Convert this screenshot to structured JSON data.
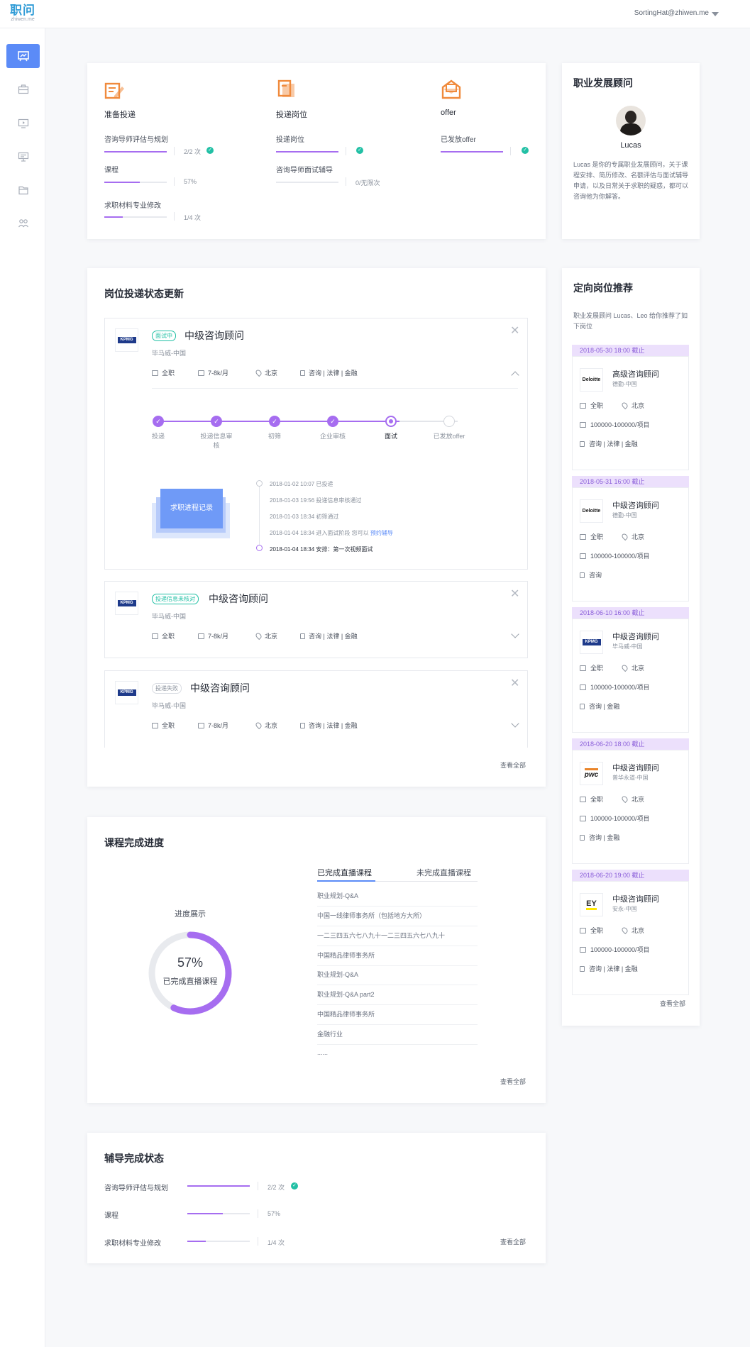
{
  "header": {
    "logo_cn": "职问",
    "logo_en": "zhiwen.me",
    "user_email": "SortingHat@zhiwen.me"
  },
  "sidebar": {
    "items": [
      {
        "icon": "presentation-chart-icon",
        "active": true
      },
      {
        "icon": "briefcase-icon",
        "active": false
      },
      {
        "icon": "monitor-icon",
        "active": false
      },
      {
        "icon": "resume-icon",
        "active": false
      },
      {
        "icon": "folder-icon",
        "active": false
      },
      {
        "icon": "people-icon",
        "active": false
      }
    ]
  },
  "overview": {
    "col1": {
      "title": "准备投递",
      "rows": [
        {
          "label": "咨询导师评估与规划",
          "value": "2/2 次",
          "progress": 1.0,
          "done": true
        },
        {
          "label": "课程",
          "value": "57%",
          "progress": 0.57,
          "done": false
        },
        {
          "label": "求职材料专业修改",
          "value": "1/4 次",
          "progress": 0.3,
          "done": false
        }
      ]
    },
    "col2": {
      "title": "投递岗位",
      "rows": [
        {
          "label": "投递岗位",
          "value": "",
          "progress": 1.0,
          "done": true
        },
        {
          "label": "咨询导师面试辅导",
          "value": "0/无限次",
          "progress": 0.0,
          "done": false
        }
      ]
    },
    "col3": {
      "title": "offer",
      "rows": [
        {
          "label": "已发放offer",
          "value": "",
          "progress": 1.0,
          "done": true
        }
      ]
    }
  },
  "advisor": {
    "section_title": "职业发展顾问",
    "name": "Lucas",
    "bio": "Lucas 是你的专属职业发展顾问，关于课程安排、简历修改、名额评估与面试辅导申请，以及日常关于求职的疑惑，都可以咨询他为你解答。"
  },
  "status_section": {
    "title": "岗位投递状态更新",
    "jobs": [
      {
        "tag": "面试中",
        "title": "中级咨询顾问",
        "company": "毕马威-中国",
        "type": "全职",
        "salary": "7-8k/月",
        "city": "北京",
        "industry": "咨询 | 法律 | 金融",
        "logo": "KPMG"
      },
      {
        "tag": "投递信息未核对",
        "title": "中级咨询顾问",
        "company": "毕马威-中国",
        "type": "全职",
        "salary": "7-8k/月",
        "city": "北京",
        "industry": "咨询 | 法律 | 金融",
        "logo": "KPMG"
      },
      {
        "tag": "投递失败",
        "title": "中级咨询顾问",
        "company": "毕马威-中国",
        "type": "全职",
        "salary": "7-8k/月",
        "city": "北京",
        "industry": "咨询 | 法律 | 金融",
        "logo": "KPMG"
      }
    ],
    "steps": [
      {
        "label": "投递",
        "state": "done"
      },
      {
        "label": "投递信息审核",
        "state": "done"
      },
      {
        "label": "初筛",
        "state": "done"
      },
      {
        "label": "企业审核",
        "state": "done"
      },
      {
        "label": "面试",
        "state": "current"
      },
      {
        "label": "已发放offer",
        "state": "todo"
      }
    ],
    "record_button": "求职进程记录",
    "timeline": [
      "2018-01-02 10:07 已投递",
      "2018-01-03 19:56 投递信息审核通过",
      "2018-01-03 18:34 初筛通过",
      "2018-01-04 18:34 进入面试阶段 您可以",
      "2018-01-04 18:34 安排：第一次视频面试"
    ],
    "timeline_link": "预约辅导",
    "view_all": "查看全部"
  },
  "course_section": {
    "title": "课程完成进度",
    "donut_title": "进度展示",
    "percent": "57%",
    "percent_value": 0.57,
    "percent_caption": "已完成直播课程",
    "tabs": [
      "已完成直播课程",
      "未完成直播课程"
    ],
    "courses": [
      "职业规划-Q&A",
      "中国一线律师事务所（包括地方大所）",
      "一二三四五六七八九十一二三四五六七八九十",
      "中国精品律师事务所",
      "职业规划-Q&A",
      "职业规划-Q&A part2",
      "中国精品律师事务所",
      "金融行业",
      "......"
    ],
    "view_all": "查看全部"
  },
  "coach_section": {
    "title": "辅导完成状态",
    "rows": [
      {
        "label": "咨询导师评估与规划",
        "value": "2/2 次",
        "progress": 1.0,
        "done": true
      },
      {
        "label": "课程",
        "value": "57%",
        "progress": 0.57,
        "done": false
      },
      {
        "label": "求职材料专业修改",
        "value": "1/4 次",
        "progress": 0.3,
        "done": false
      }
    ],
    "view_all": "查看全部"
  },
  "recommend": {
    "title": "定向岗位推荐",
    "intro": "职业发展顾问 Lucas、Leo 给你推荐了如下岗位",
    "items": [
      {
        "deadline": "2018-05-30 18:00 截止",
        "title": "高级咨询顾问",
        "company": "德勤-中国",
        "type": "全职",
        "city": "北京",
        "salary": "100000-100000/项目",
        "industry": "咨询 | 法律 | 金融",
        "logo": "Deloitte"
      },
      {
        "deadline": "2018-05-31 16:00 截止",
        "title": "中级咨询顾问",
        "company": "德勤-中国",
        "type": "全职",
        "city": "北京",
        "salary": "100000-100000/项目",
        "industry": "咨询",
        "logo": "Deloitte"
      },
      {
        "deadline": "2018-06-10 16:00 截止",
        "title": "中级咨询顾问",
        "company": "毕马威-中国",
        "type": "全职",
        "city": "北京",
        "salary": "100000-100000/项目",
        "industry": "咨询 | 金融",
        "logo": "KPMG"
      },
      {
        "deadline": "2018-06-20 18:00 截止",
        "title": "中级咨询顾问",
        "company": "普华永道-中国",
        "type": "全职",
        "city": "北京",
        "salary": "100000-100000/项目",
        "industry": "咨询 | 金融",
        "logo": "pwc"
      },
      {
        "deadline": "2018-06-20 19:00 截止",
        "title": "中级咨询顾问",
        "company": "安永-中国",
        "type": "全职",
        "city": "北京",
        "salary": "100000-100000/项目",
        "industry": "咨询 | 法律 | 金融",
        "logo": "EY"
      }
    ],
    "view_all": "查看全部"
  },
  "colors": {
    "accent": "#a66df0",
    "blue": "#5b8bf7",
    "orange": "#f08a3c",
    "green": "#22c0a5"
  }
}
